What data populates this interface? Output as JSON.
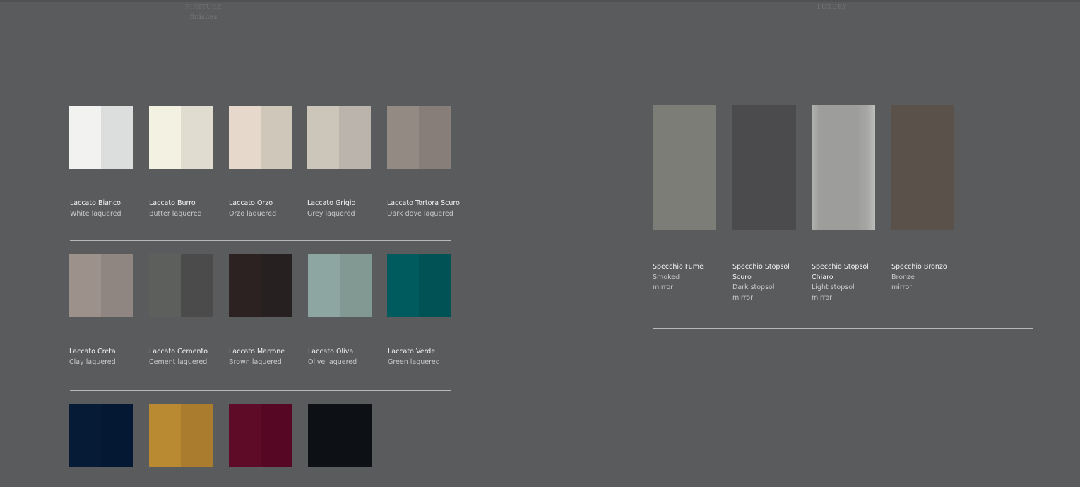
{
  "header_left": {
    "title": "FINITURE",
    "subtitle": "finishes"
  },
  "header_right": {
    "title": "LUXURY"
  },
  "lacquered": [
    {
      "name": "Laccato Bianco",
      "desc": "White laquered",
      "colors": [
        "#f2f2f0",
        "#dcdedd"
      ]
    },
    {
      "name": "Laccato Burro",
      "desc": "Butter laquered",
      "colors": [
        "#f3f1e1",
        "#e0ddd0"
      ]
    },
    {
      "name": "Laccato Orzo",
      "desc": "Orzo laquered",
      "colors": [
        "#e6d9cb",
        "#d0c7bb"
      ]
    },
    {
      "name": "Laccato Grigio",
      "desc": "Grey laquered",
      "colors": [
        "#ccc5ba",
        "#bab4ad"
      ]
    },
    {
      "name": "Laccato Tortora Scuro",
      "desc": "Dark dove laquered",
      "colors": [
        "#948a84",
        "#877d79"
      ]
    },
    {
      "name": "Laccato Creta",
      "desc": "Clay laquered",
      "colors": [
        "#9c928b",
        "#8f8581"
      ]
    },
    {
      "name": "Laccato Cemento",
      "desc": "Cement laquered",
      "colors": [
        "#5d5f5d",
        "#4a4b4a"
      ]
    },
    {
      "name": "Laccato Marrone",
      "desc": "Brown laquered",
      "colors": [
        "#2c2222",
        "#272021"
      ]
    },
    {
      "name": "Laccato Oliva",
      "desc": "Olive laquered",
      "colors": [
        "#8ea6a1",
        "#819893"
      ]
    },
    {
      "name": "Laccato Verde",
      "desc": "Green laquered",
      "colors": [
        "#005b5e",
        "#015255"
      ]
    }
  ],
  "bottom_swatches": [
    {
      "colors": [
        "#061b36",
        "#041833"
      ]
    },
    {
      "colors": [
        "#b98a31",
        "#aa7d2e"
      ]
    },
    {
      "colors": [
        "#5d0b27",
        "#550724"
      ]
    },
    {
      "colors": [
        "#0d1014",
        "#0d1014"
      ]
    }
  ],
  "mirrors": [
    {
      "name": "Specchio Fumè",
      "desc_lines": [
        "Smoked",
        "mirror"
      ],
      "color": "#7c7d77"
    },
    {
      "name": "Specchio Stopsol Scuro",
      "name_lines": [
        "Specchio Stopsol",
        "Scuro"
      ],
      "desc_lines": [
        "Dark stopsol",
        "mirror"
      ],
      "color": "#4b4b4d"
    },
    {
      "name": "Specchio Stopsol Chiaro",
      "name_lines": [
        "Specchio Stopsol",
        "Chiaro"
      ],
      "desc_lines": [
        "Light stopsol",
        "mirror"
      ],
      "color": "#9d9d9c"
    },
    {
      "name": "Specchio Bronzo",
      "desc_lines": [
        "Bronze",
        "mirror"
      ],
      "color": "#5b514b"
    }
  ]
}
